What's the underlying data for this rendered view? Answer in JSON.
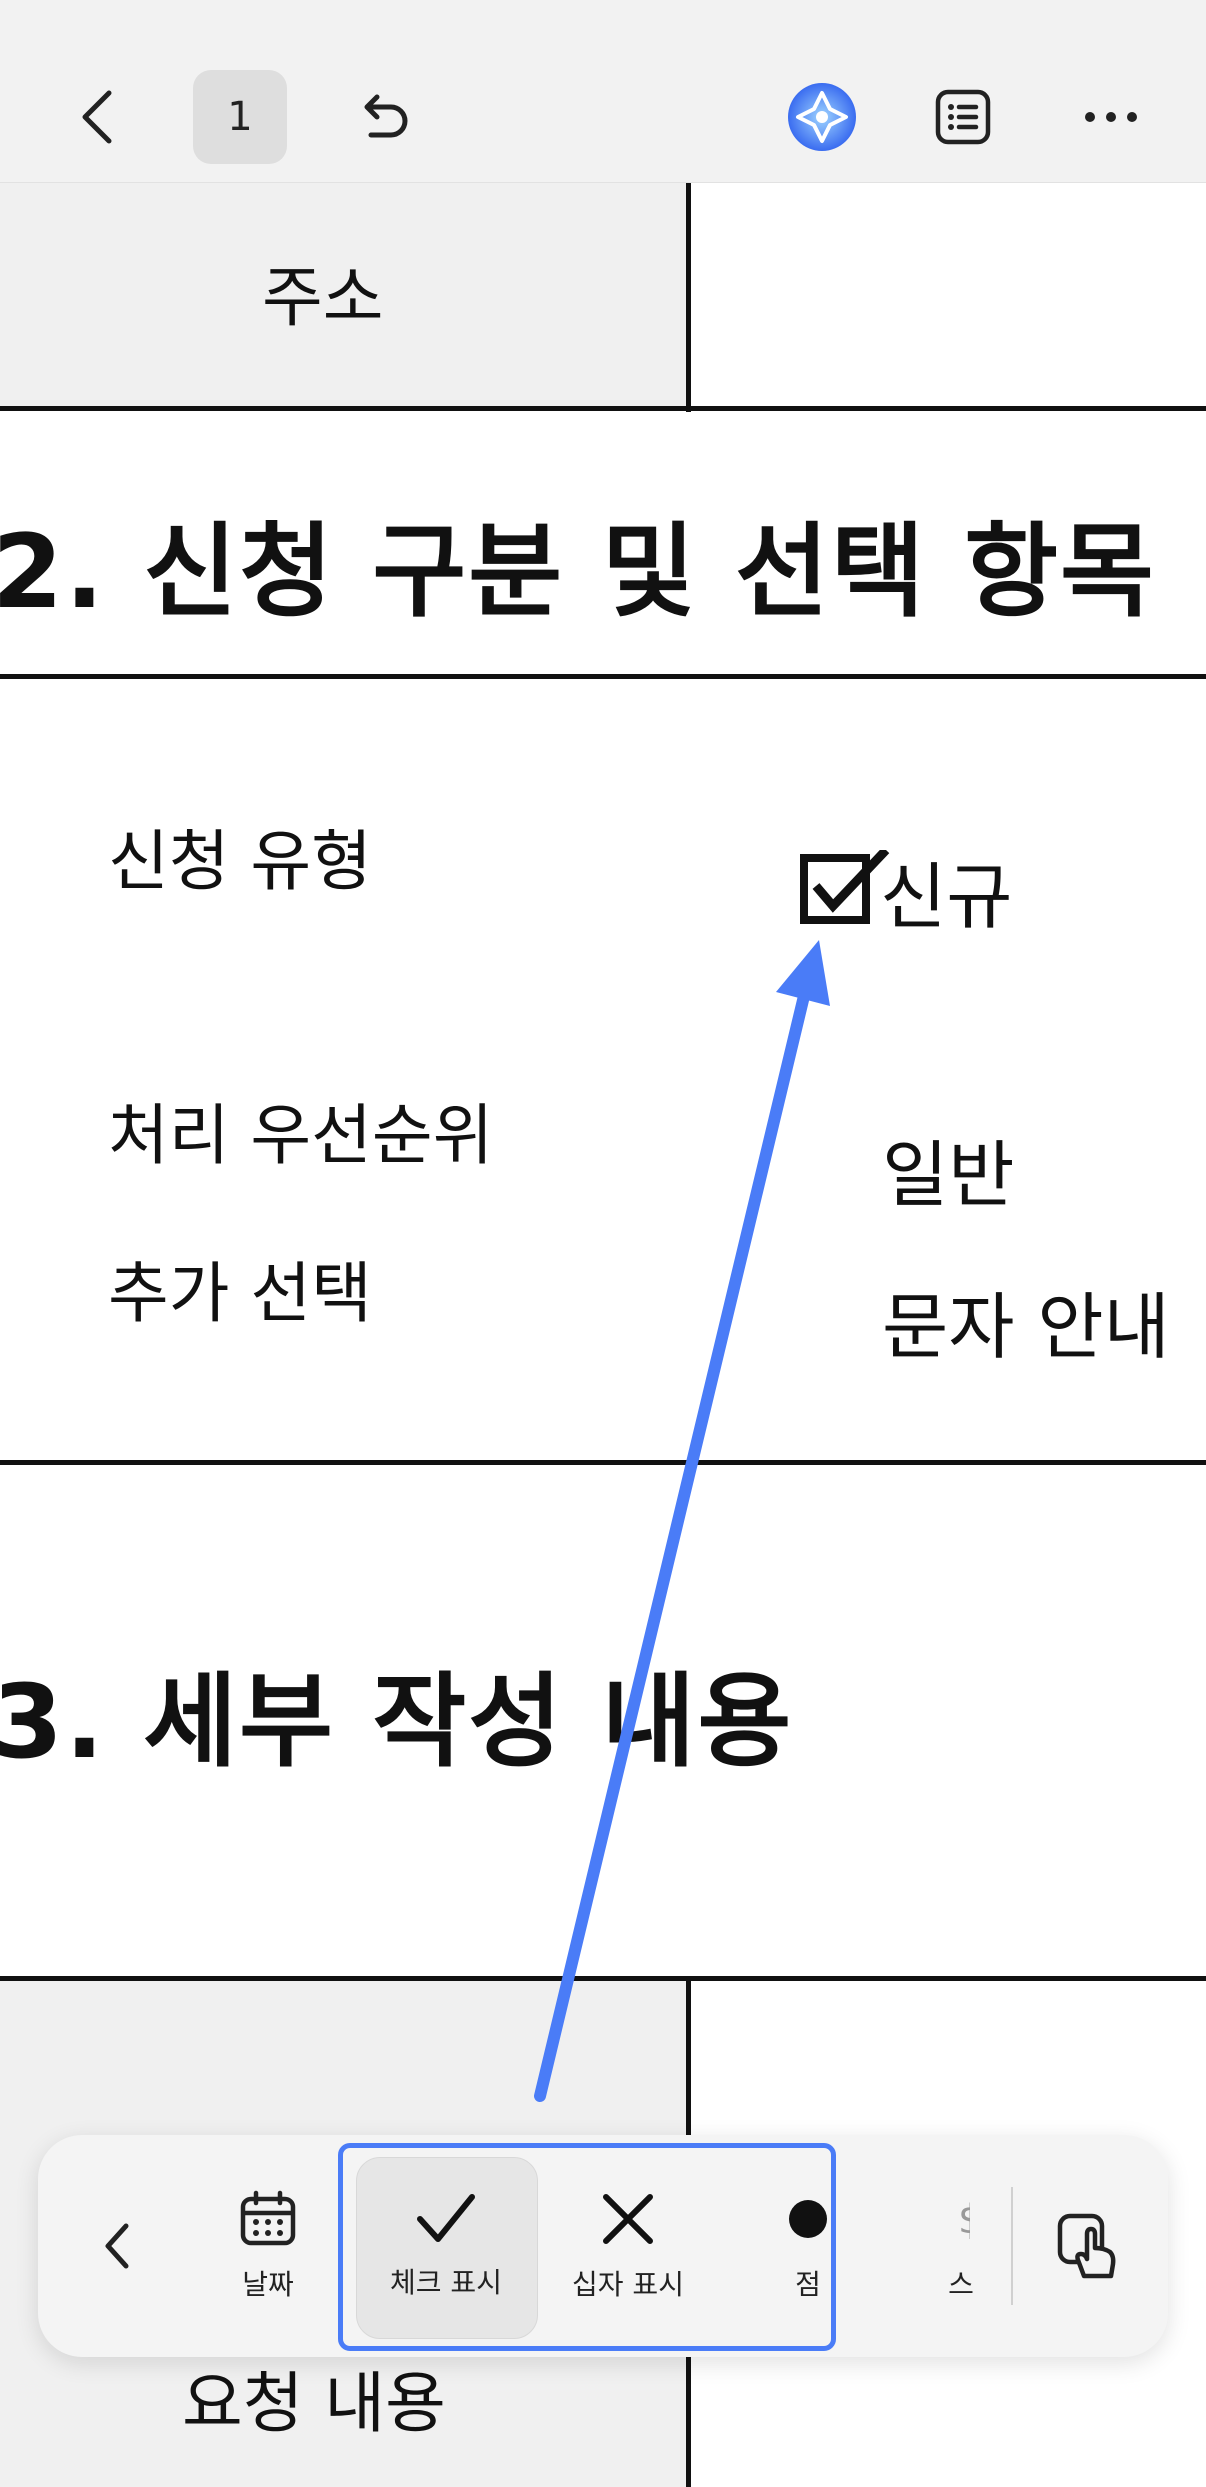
{
  "topbar": {
    "page_number": "1",
    "icons": [
      "back-chevron-icon",
      "undo-icon",
      "ai-assistant-icon",
      "list-icon",
      "more-icon"
    ]
  },
  "document": {
    "address_label": "주소",
    "section2_heading": "2. 신청 구분 및 선택 항목",
    "type_label": "신청 유형",
    "type_value": "신규",
    "priority_label": "처리 우선순위",
    "priority_value": "일반",
    "extra_label": "추가 선택",
    "extra_value": "문자 안내",
    "section3_heading": "3. 세부 작성 내용",
    "request_label": "요청 내용"
  },
  "toolbar": {
    "date_label": "날짜",
    "check_label": "체크 표시",
    "cross_label": "십자 표시",
    "dot_label": "점",
    "partial_label": "스",
    "icons": [
      "calendar-icon",
      "checkmark-icon",
      "cross-icon",
      "dot-icon",
      "touch-mode-icon"
    ]
  },
  "colors": {
    "accent_blue": "#4a7cf7",
    "toolbar_bg": "#f4f4f4",
    "topbar_bg": "#f2f2f2"
  }
}
